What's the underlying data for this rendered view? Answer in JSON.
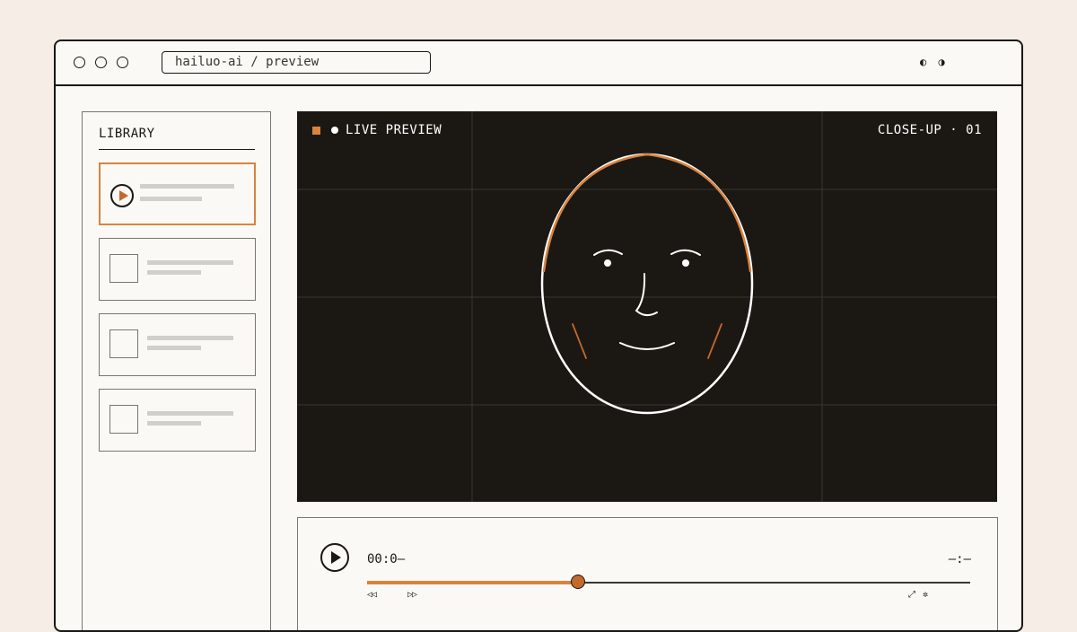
{
  "window": {
    "url": "hailuo-ai / preview",
    "theme_icons": "◐ ◑"
  },
  "sidebar": {
    "title": "LIBRARY",
    "items": [
      {
        "active": true,
        "icon": "play-icon"
      },
      {
        "active": false,
        "icon": "thumbnail-placeholder"
      },
      {
        "active": false,
        "icon": "thumbnail-placeholder"
      },
      {
        "active": false,
        "icon": "thumbnail-placeholder"
      }
    ]
  },
  "preview": {
    "live_label": "LIVE PREVIEW",
    "shot_label": "CLOSE-UP · 01",
    "subject": "face-line-drawing"
  },
  "player": {
    "current_time": "00:0—",
    "duration": "—:—",
    "progress": 0.35,
    "rewind_icon": "◁◁",
    "forward_icon": "▷▷",
    "expand_icon": "⤢",
    "settings_icon": "✲"
  },
  "colors": {
    "accent": "#d8833f",
    "accent_dark": "#c4682c",
    "ink": "#1b1814",
    "paper": "#faf9f5",
    "background": "#f6eee6",
    "preview_bg": "#1b1814"
  }
}
